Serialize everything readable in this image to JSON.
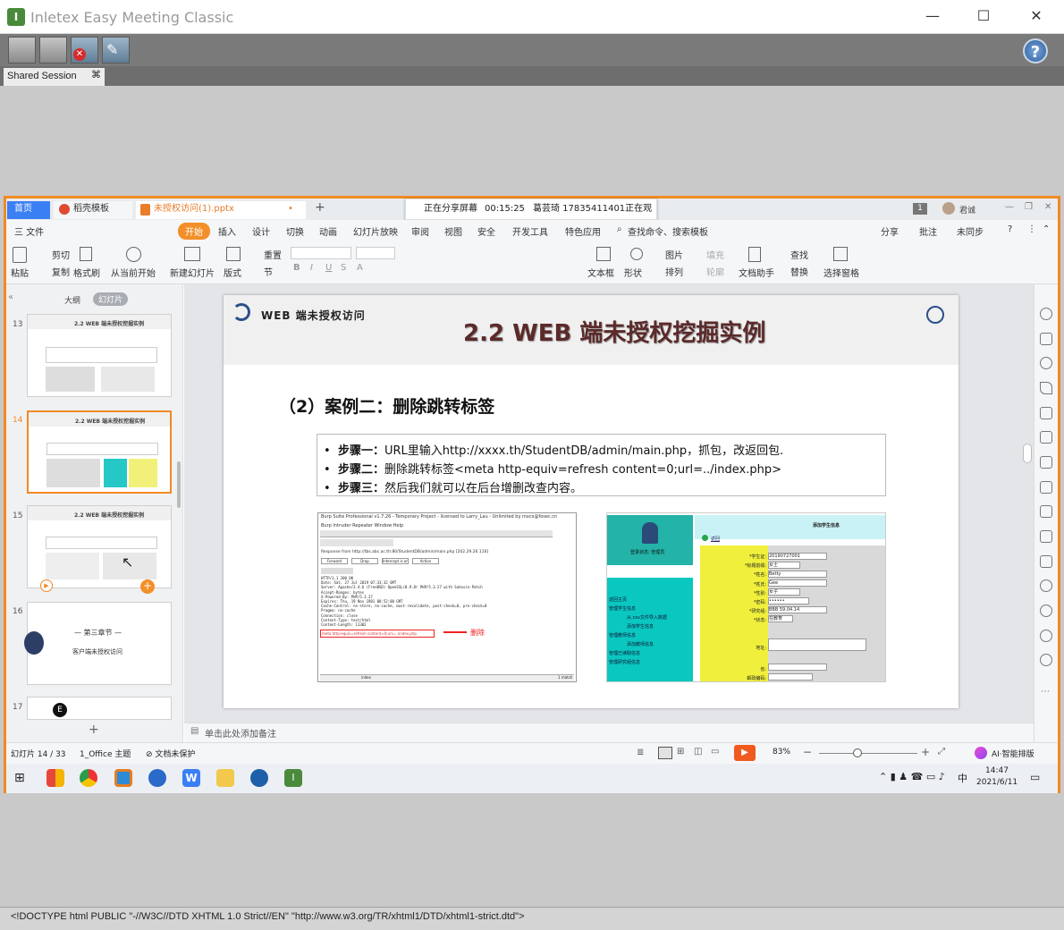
{
  "app": {
    "title": "Inletex Easy Meeting Classic",
    "help": "?"
  },
  "session_tab": {
    "label": "Shared Session",
    "close": "⌘"
  },
  "share_banner": {
    "status": "正在分享屏幕",
    "elapsed": "00:15:25",
    "viewer": "葛芸琦 17835411401正在观看"
  },
  "wps": {
    "tabs": [
      "首页",
      "稻壳模板",
      "未授权访问(1).pptx"
    ],
    "user": "君诚",
    "page_badge": "1",
    "menus": [
      "三 文件",
      "开始",
      "插入",
      "设计",
      "切换",
      "动画",
      "幻灯片放映",
      "审阅",
      "视图",
      "安全",
      "开发工具",
      "特色应用"
    ],
    "search": "查找命令、搜索模板",
    "right_actions": [
      "分享",
      "批注",
      "未同步"
    ],
    "ribbon": {
      "paste": "粘贴",
      "cut": "剪切",
      "copy": "复制",
      "format_brush": "格式刷",
      "from_current": "从当前开始",
      "new_slide": "新建幻灯片",
      "layout": "版式",
      "reset": "重置",
      "section": "节",
      "textbox": "文本框",
      "shape": "形状",
      "picture": "图片",
      "arrange": "排列",
      "fill": "填充",
      "outline": "轮廓",
      "assistant": "文档助手",
      "find": "查找",
      "replace": "替换",
      "select_pane": "选择窗格"
    },
    "pane_tabs": [
      "大纲",
      "幻灯片"
    ],
    "thumbs": [
      {
        "num": "13",
        "title": "2.2 WEB 端未授权挖掘实例"
      },
      {
        "num": "14",
        "title": "2.2 WEB 端未授权挖掘实例"
      },
      {
        "num": "15",
        "title": "2.2 WEB 端未授权挖掘实例"
      },
      {
        "num": "16",
        "title": "— 第三章节 —",
        "subtitle": "客户端未授权访问"
      },
      {
        "num": "17",
        "title": ""
      }
    ],
    "notes_placeholder": "单击此处添加备注",
    "status": {
      "slide": "幻灯片 14 / 33",
      "theme": "1_Office 主题",
      "protect": "文档未保护",
      "zoom": "83%",
      "ai": "AI·智能排版"
    }
  },
  "slide": {
    "header_label": "WEB 端未授权访问",
    "title": "2.2 WEB 端未授权挖掘实例",
    "subtitle": "（2）案例二：删除跳转标签",
    "steps": [
      {
        "label": "步骤一：",
        "text": "URL里输入http://xxxx.th/StudentDB/admin/main.php，抓包，改返回包."
      },
      {
        "label": "步骤二：",
        "text": "删除跳转标签<meta http-equiv=refresh content=0;url=../index.php>"
      },
      {
        "label": "步骤三：",
        "text": "然后我们就可以在后台增删改查内容。"
      }
    ],
    "burp": {
      "title": "Burp Suite Professional v1.7.26 - Temporary Project - licensed to Larry_Lau - Unlimited by mxcx@fosec.cn",
      "menu": "Burp  Intruder  Repeater  Window  Help",
      "response_from": "Response from http://tbs.abc.ac.th:80/StudentDB/admin/main.php  [202.29.26.116]",
      "buttons": [
        "Forward",
        "Drop",
        "Intercept is on",
        "Action"
      ],
      "code": [
        "HTTP/1.1 200 OK",
        "Date: Sat, 27 Jul 2019 07:33:32 GMT",
        "Server: Apache/2.4.6 (FreeBSD) OpenSSL/0.9.8r PHP/5.3.27 with Suhosin-Patch",
        "Accept-Ranges: bytes",
        "X-Powered-By: PHP/5.3.27",
        "Expires: Thu, 19 Nov 1981 08:52:00 GMT",
        "Cache-Control: no-store, no-cache, must-revalidate, post-check=0, pre-check=0",
        "Pragma: no-cache",
        "Connection: close",
        "Content-Type: text/html",
        "Content-Length: 11302"
      ],
      "highlight": "meta http-equiv=refresh content=0;url=../index.php",
      "delete_label": "删除",
      "search": "index",
      "match": "1 match"
    },
    "form": {
      "title": "添加学生信息",
      "login_status": "登录状态: 管理员",
      "back": "返回",
      "fields": [
        {
          "label": "*学生证:",
          "value": "20190727001"
        },
        {
          "label": "*标题前缀:",
          "value": "女士"
        },
        {
          "label": "*姓名:",
          "value": "Betty"
        },
        {
          "label": "*姓氏:",
          "value": "Gee"
        },
        {
          "label": "*性别:",
          "value": "女子"
        },
        {
          "label": "*密码:",
          "value": "••••••"
        },
        {
          "label": "*研究组:",
          "value": "BBB 59.04.14"
        },
        {
          "label": "*状态:",
          "value": "在教育"
        },
        {
          "label": "地址:",
          "value": ""
        },
        {
          "label": "省:",
          "value": ""
        },
        {
          "label": "邮政编码:",
          "value": ""
        }
      ],
      "menu": [
        "返回主页",
        "管理学生信息",
        "从.csv文件导入数据",
        "添加学生信息",
        "管理教师信息",
        "添加教师信息",
        "管理已读取信息",
        "管理研究组信息"
      ]
    }
  },
  "taskbar": {
    "time": "14:47",
    "date": "2021/6/11",
    "ime": "中"
  },
  "bottom_text": "<!DOCTYPE html PUBLIC \"-//W3C//DTD XHTML 1.0 Strict//EN\" \"http://www.w3.org/TR/xhtml1/DTD/xhtml1-strict.dtd\">"
}
